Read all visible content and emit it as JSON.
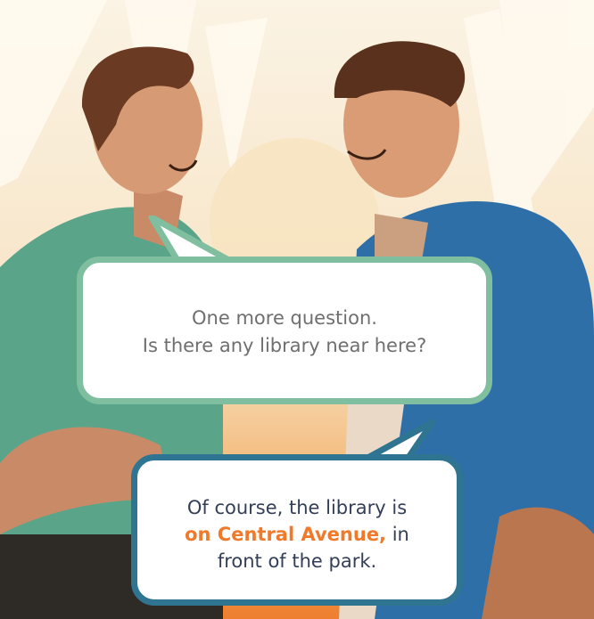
{
  "speech_bubble_top": {
    "line_1": "One more question.",
    "line_2": "Is there any library near here?"
  },
  "speech_bubble_bottom": {
    "line_1": "Of course, the library is",
    "highlight": "on Central Avenue,",
    "line_2_rest": " in",
    "line_3": "front of the park."
  },
  "colors": {
    "bubble_top_border": "#7fbf9f",
    "bubble_bottom_border": "#2f7591",
    "highlight": "#f07a2a",
    "background_warm": "#f7ebd6",
    "background_orange": "#f08a3a"
  }
}
